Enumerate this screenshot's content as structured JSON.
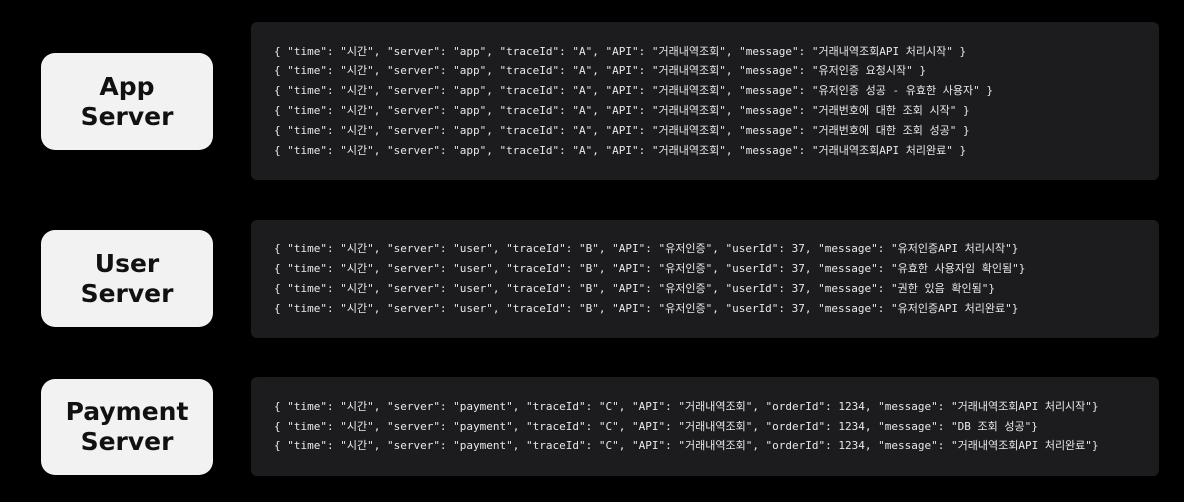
{
  "servers": [
    {
      "label_line1": "App",
      "label_line2": "Server",
      "logs": [
        "{ \"time\": \"시간\", \"server\": \"app\", \"traceId\": \"A\", \"API\": \"거래내역조회\", \"message\": \"거래내역조회API 처리시작\" }",
        "{ \"time\": \"시간\", \"server\": \"app\", \"traceId\": \"A\", \"API\": \"거래내역조회\", \"message\": \"유저인증 요청시작\" }",
        "{ \"time\": \"시간\", \"server\": \"app\", \"traceId\": \"A\", \"API\": \"거래내역조회\", \"message\": \"유저인증 성공 - 유효한 사용자\" }",
        "{ \"time\": \"시간\", \"server\": \"app\", \"traceId\": \"A\", \"API\": \"거래내역조회\", \"message\": \"거래번호에 대한 조회 시작\" }",
        "{ \"time\": \"시간\", \"server\": \"app\", \"traceId\": \"A\", \"API\": \"거래내역조회\", \"message\": \"거래번호에 대한 조회 성공\" }",
        "{ \"time\": \"시간\", \"server\": \"app\", \"traceId\": \"A\", \"API\": \"거래내역조회\", \"message\": \"거래내역조회API 처리완료\" }"
      ]
    },
    {
      "label_line1": "User",
      "label_line2": "Server",
      "logs": [
        "{ \"time\": \"시간\", \"server\": \"user\", \"traceId\": \"B\", \"API\": \"유저인증\", \"userId\": 37, \"message\": \"유저인증API 처리시작\"}",
        "{ \"time\": \"시간\", \"server\": \"user\", \"traceId\": \"B\", \"API\": \"유저인증\", \"userId\": 37, \"message\": \"유효한 사용자임 확인됨\"}",
        "{ \"time\": \"시간\", \"server\": \"user\", \"traceId\": \"B\", \"API\": \"유저인증\", \"userId\": 37, \"message\": \"권한 있음 확인됨\"}",
        "{ \"time\": \"시간\", \"server\": \"user\", \"traceId\": \"B\", \"API\": \"유저인증\", \"userId\": 37, \"message\": \"유저인증API 처리완료\"}"
      ]
    },
    {
      "label_line1": "Payment",
      "label_line2": "Server",
      "logs": [
        "{ \"time\": \"시간\", \"server\": \"payment\", \"traceId\": \"C\", \"API\": \"거래내역조회\", \"orderId\": 1234, \"message\": \"거래내역조회API 처리시작\"}",
        "{ \"time\": \"시간\", \"server\": \"payment\", \"traceId\": \"C\", \"API\": \"거래내역조회\", \"orderId\": 1234, \"message\": \"DB 조회 성공\"}",
        "{ \"time\": \"시간\", \"server\": \"payment\", \"traceId\": \"C\", \"API\": \"거래내역조회\", \"orderId\": 1234, \"message\": \"거래내역조회API 처리완료\"}"
      ]
    }
  ],
  "colors": {
    "background": "#000000",
    "label_box": "#f2f2f2",
    "label_text": "#111111",
    "log_panel": "#1c1c1e",
    "log_text": "#e8e8e8"
  }
}
